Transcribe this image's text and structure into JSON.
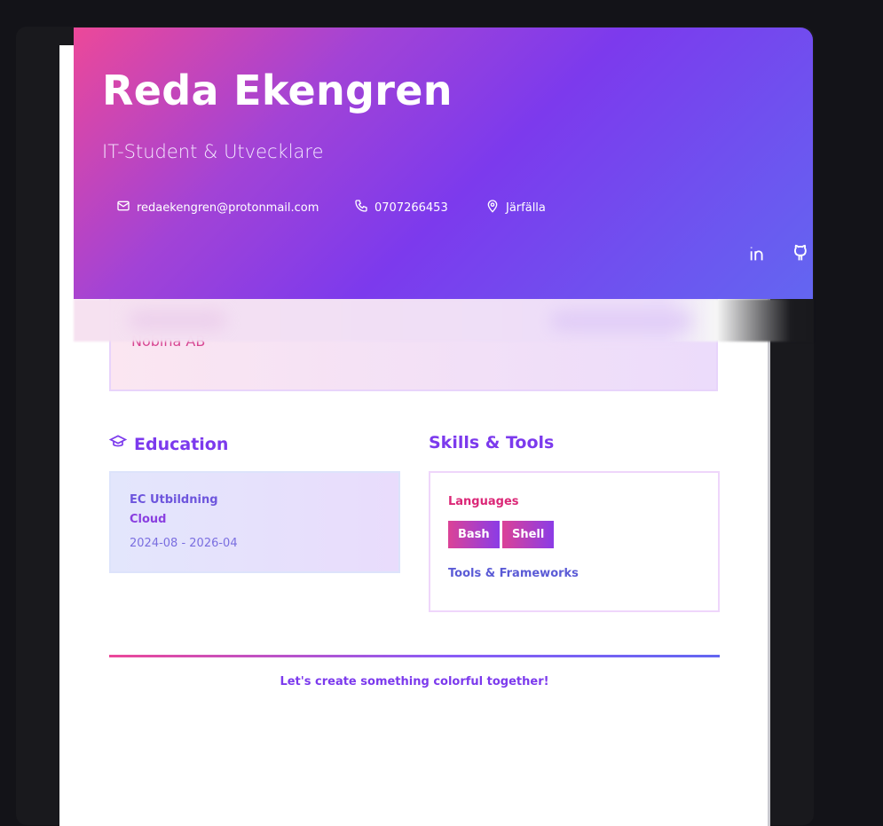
{
  "header": {
    "name": "Reda Ekengren",
    "title": "IT-Student & Utvecklare",
    "contacts": {
      "email": "redaekengren@protonmail.com",
      "phone": "0707266453",
      "location": "Järfälla"
    },
    "social": {
      "linkedin_icon": "linkedin-icon",
      "github_icon": "github-icon"
    }
  },
  "experience": {
    "company": "Nobina AB"
  },
  "education": {
    "title": "Education",
    "icon": "graduation-cap-icon",
    "items": [
      {
        "school": "EC Utbildning",
        "program": "Cloud",
        "dates": "2024-08 - 2026-04"
      }
    ]
  },
  "skills": {
    "title": "Skills & Tools",
    "languages_label": "Languages",
    "languages": [
      "Bash",
      "Shell"
    ],
    "tools_label": "Tools & Frameworks"
  },
  "footer": {
    "text": "Let's create something colorful together!"
  },
  "colors": {
    "pink": "#ec4899",
    "purple": "#7c3aed",
    "indigo": "#6366f1",
    "background": "#131318"
  }
}
